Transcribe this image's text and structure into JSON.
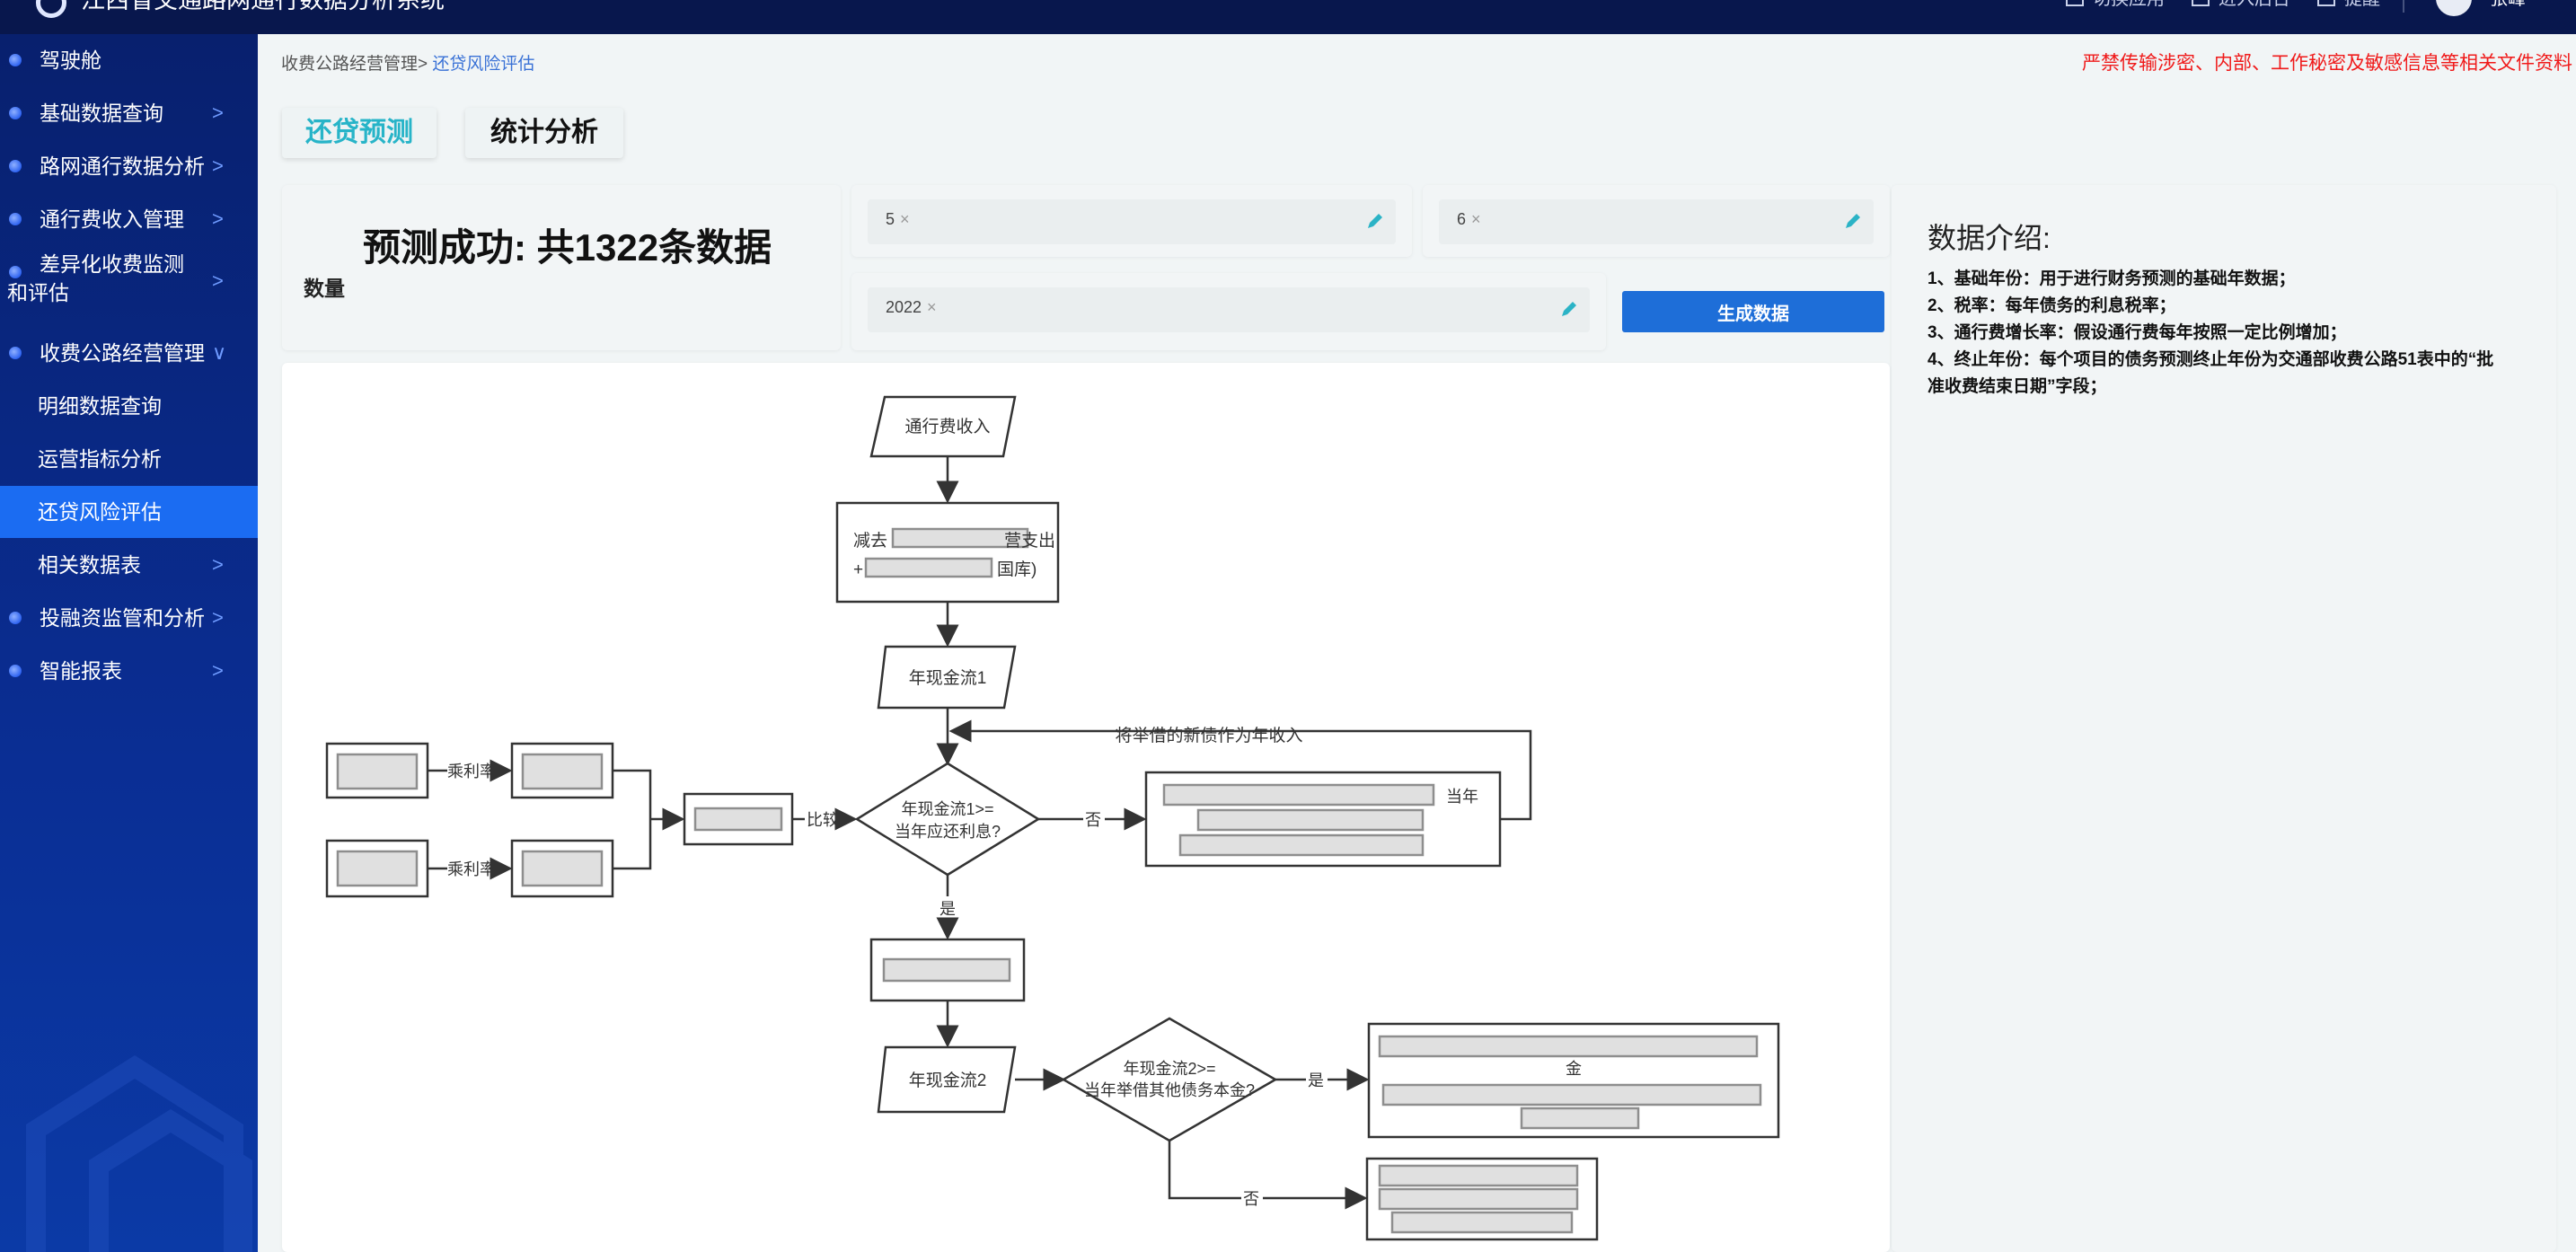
{
  "header": {
    "app_title": "江西省交通路网通行数据分析系统",
    "actions": [
      "切换应用",
      "进入后台",
      "提醒"
    ],
    "user": "张峰"
  },
  "sidebar": {
    "items": [
      {
        "label": "驾驶舱",
        "chevron": ""
      },
      {
        "label": "基础数据查询",
        "chevron": ">"
      },
      {
        "label": "路网通行数据分析",
        "chevron": ">"
      },
      {
        "label": "通行费收入管理",
        "chevron": ">"
      },
      {
        "label": "差异化收费监测和评估",
        "chevron": ">"
      },
      {
        "label": "收费公路经营管理",
        "chevron": "∨"
      }
    ],
    "sub_items": [
      {
        "label": "明细数据查询"
      },
      {
        "label": "运营指标分析"
      },
      {
        "label": "还贷风险评估"
      },
      {
        "label": "相关数据表",
        "chevron": ">"
      }
    ],
    "items_after": [
      {
        "label": "投融资监管和分析",
        "chevron": ">"
      },
      {
        "label": "智能报表",
        "chevron": ">"
      }
    ]
  },
  "breadcrumb": {
    "parent": "收费公路经营管理>",
    "current": "还贷风险评估"
  },
  "warning": "严禁传输涉密、内部、工作秘密及敏感信息等相关文件资料",
  "tabs": [
    {
      "label": "还贷预测"
    },
    {
      "label": "统计分析"
    }
  ],
  "result": {
    "title": "预测成功: 共1322条数据",
    "subtitle": "数量"
  },
  "params": {
    "tax_rate": "5",
    "growth_rate": "6",
    "base_year": "2022",
    "remove_symbol": "×"
  },
  "generate_button": "生成数据",
  "intro": {
    "title": "数据介绍:",
    "items": [
      "1、基础年份：用于进行财务预测的基础年数据；",
      "2、税率：每年债务的利息税率；",
      "3、通行费增长率：假设通行费每年按照一定比例增加；",
      "4、终止年份：每个项目的债务预测终止年份为交通部收费公路51表中的“批准收费结束日期”字段；"
    ]
  },
  "flowchart": {
    "toll_income": "通行费收入",
    "expense_line1": "减去",
    "expense_line2": "营支出",
    "expense_line3": "+",
    "expense_line4": "国库)",
    "annual_cashflow_1": "年现金流1",
    "new_debt_note": "将举借的新债作为年收入",
    "multiply_rate_a": "乘利率",
    "multiply_rate_b": "乘利率",
    "compare": "比较",
    "decision_1_line1": "年现金流1>=",
    "decision_1_line2": "当年应还利息?",
    "no_1": "否",
    "yes_1": "是",
    "right_box_line1": "当年",
    "annual_cashflow_2": "年现金流2",
    "decision_2_line1": "年现金流2>=",
    "decision_2_line2": "当年举借其他债务本金?",
    "yes_2": "是",
    "no_2": "否",
    "right_box2_line1": "金"
  }
}
